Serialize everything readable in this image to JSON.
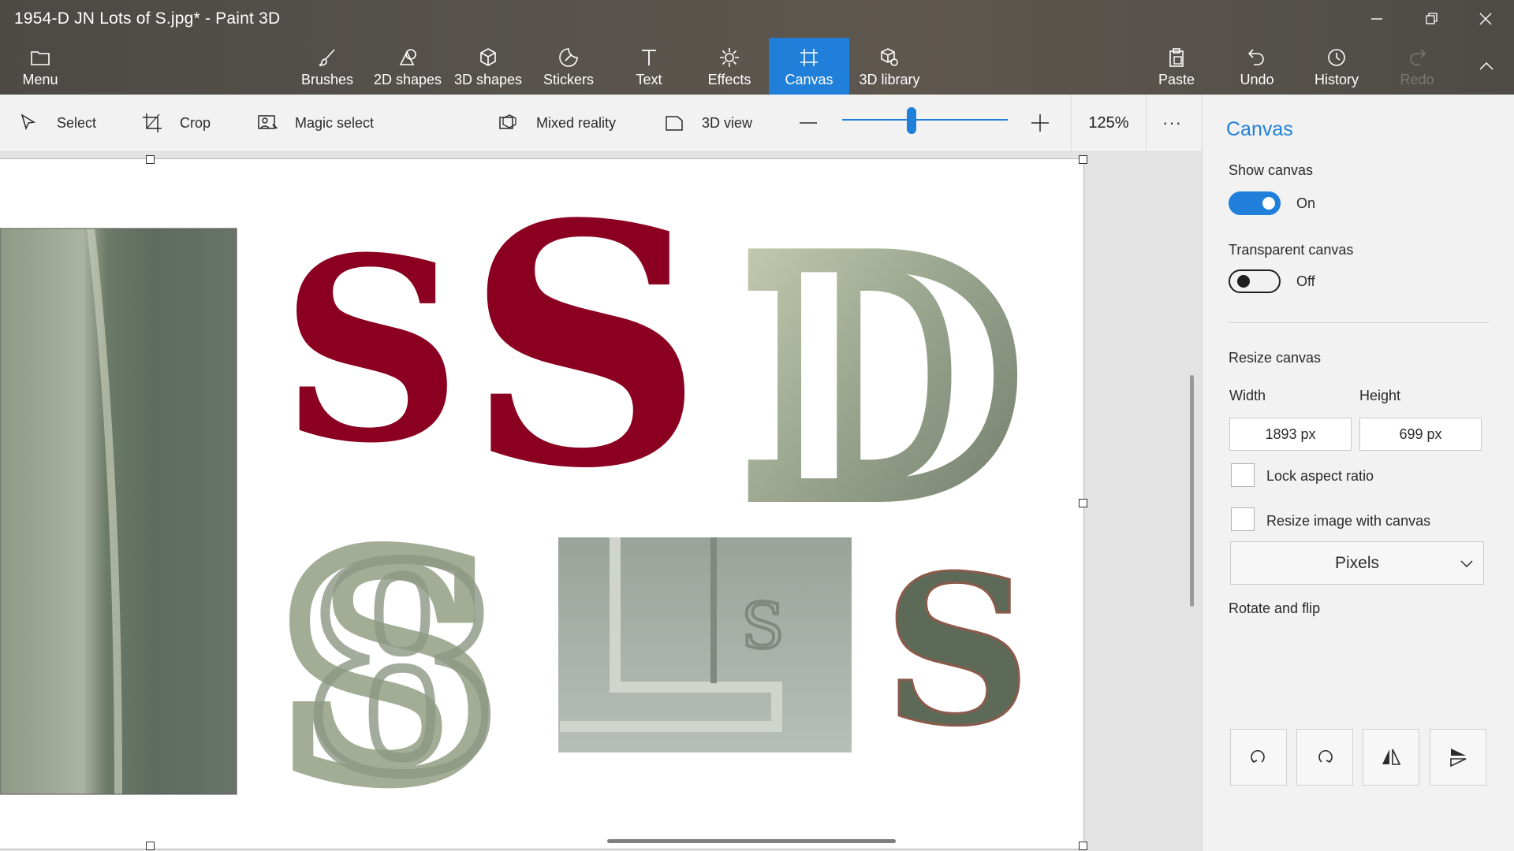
{
  "window": {
    "title": "1954-D JN Lots of S.jpg* - Paint 3D"
  },
  "ribbon": {
    "menu_label": "Menu",
    "tools": [
      {
        "label": "Brushes"
      },
      {
        "label": "2D shapes"
      },
      {
        "label": "3D shapes"
      },
      {
        "label": "Stickers"
      },
      {
        "label": "Text"
      },
      {
        "label": "Effects"
      },
      {
        "label": "Canvas"
      },
      {
        "label": "3D library"
      }
    ],
    "active_tool": "Canvas",
    "paste_label": "Paste",
    "undo_label": "Undo",
    "history_label": "History",
    "redo_label": "Redo"
  },
  "toolbar": {
    "select_label": "Select",
    "crop_label": "Crop",
    "magic_select_label": "Magic select",
    "mixed_reality_label": "Mixed reality",
    "view3d_label": "3D view",
    "zoom_value": "125%",
    "zoom_slider_fraction": 0.42,
    "more_label": "···"
  },
  "panel": {
    "title": "Canvas",
    "show_canvas_label": "Show canvas",
    "show_canvas_state": "On",
    "transparent_canvas_label": "Transparent canvas",
    "transparent_canvas_state": "Off",
    "resize_label": "Resize canvas",
    "width_label": "Width",
    "height_label": "Height",
    "width_value": "1893 px",
    "height_value": "699 px",
    "lock_aspect_label": "Lock aspect ratio",
    "resize_image_label": "Resize image with canvas",
    "units_value": "Pixels",
    "rotate_flip_label": "Rotate and flip"
  },
  "colors": {
    "accent": "#1f7fd9",
    "letter_red": "#8b0020"
  }
}
